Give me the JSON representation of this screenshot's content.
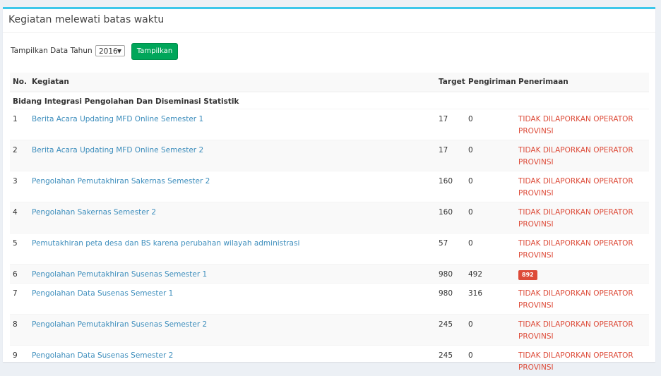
{
  "title": "Kegiatan melewati batas waktu",
  "filter": {
    "label": "Tampilkan Data Tahun :",
    "year": "2016",
    "button": "Tampilkan"
  },
  "table": {
    "headers": {
      "no": "No.",
      "kegiatan": "Kegiatan",
      "target": "Target",
      "pengiriman": "Pengiriman",
      "penerimaan": "Penerimaan"
    },
    "group": "Bidang Integrasi Pengolahan Dan Diseminasi Statistik",
    "rows": [
      {
        "no": "1",
        "kegiatan": "Berita Acara Updating MFD Online Semester 1",
        "target": "17",
        "pengiriman": "0",
        "penerimaan": "TIDAK DILAPORKAN OPERATOR PROVINSI"
      },
      {
        "no": "2",
        "kegiatan": "Berita Acara Updating MFD Online Semester 2",
        "target": "17",
        "pengiriman": "0",
        "penerimaan": "TIDAK DILAPORKAN OPERATOR PROVINSI"
      },
      {
        "no": "3",
        "kegiatan": "Pengolahan Pemutakhiran Sakernas Semester 2",
        "target": "160",
        "pengiriman": "0",
        "penerimaan": "TIDAK DILAPORKAN OPERATOR PROVINSI"
      },
      {
        "no": "4",
        "kegiatan": "Pengolahan Sakernas Semester 2",
        "target": "160",
        "pengiriman": "0",
        "penerimaan": "TIDAK DILAPORKAN OPERATOR PROVINSI"
      },
      {
        "no": "5",
        "kegiatan": "Pemutakhiran peta desa dan BS karena perubahan wilayah administrasi",
        "target": "57",
        "pengiriman": "0",
        "penerimaan": "TIDAK DILAPORKAN OPERATOR PROVINSI"
      },
      {
        "no": "6",
        "kegiatan": "Pengolahan Pemutakhiran Susenas Semester 1",
        "target": "980",
        "pengiriman": "492",
        "penerimaan_badge": "892"
      },
      {
        "no": "7",
        "kegiatan": "Pengolahan Data Susenas Semester 1",
        "target": "980",
        "pengiriman": "316",
        "penerimaan": "TIDAK DILAPORKAN OPERATOR PROVINSI"
      },
      {
        "no": "8",
        "kegiatan": "Pengolahan Pemutakhiran Susenas Semester 2",
        "target": "245",
        "pengiriman": "0",
        "penerimaan": "TIDAK DILAPORKAN OPERATOR PROVINSI"
      },
      {
        "no": "9",
        "kegiatan": "Pengolahan Data Susenas Semester 2",
        "target": "245",
        "pengiriman": "0",
        "penerimaan": "TIDAK DILAPORKAN OPERATOR PROVINSI"
      }
    ]
  }
}
